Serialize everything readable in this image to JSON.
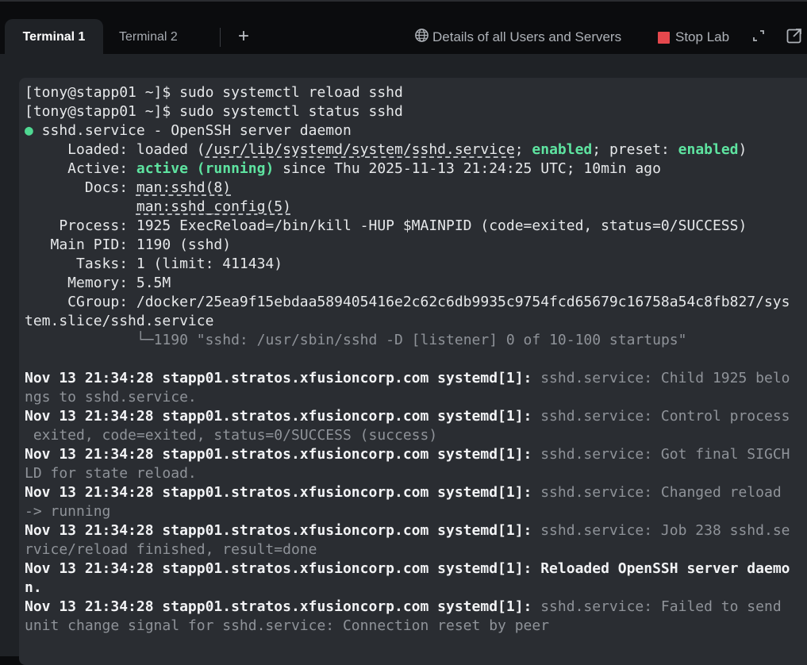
{
  "tabs": {
    "terminal1": "Terminal 1",
    "terminal2": "Terminal 2",
    "add": "+"
  },
  "toolbar": {
    "details_label": "Details of all Users and Servers",
    "stop_label": "Stop Lab",
    "stop_color": "#e5484d"
  },
  "icons": {
    "globe": "globe-icon",
    "expand": "expand-icon",
    "popout": "open-external-icon"
  },
  "terminal": {
    "l01_prompt": "[tony@stapp01 ~]$ ",
    "l01_cmd": "sudo systemctl reload sshd",
    "l02_prompt": "[tony@stapp01 ~]$ ",
    "l02_cmd": "sudo systemctl status sshd",
    "l03_dot": "●",
    "l03_text": " sshd.service - OpenSSH server daemon",
    "l04_a": "     Loaded: loaded (",
    "l04_path": "/usr/lib/systemd/system/sshd.service",
    "l04_b": "; ",
    "l04_en1": "enabled",
    "l04_c": "; preset: ",
    "l04_en2": "enabled",
    "l04_d": ")",
    "l05_a": "     Active: ",
    "l05_active": "active (running)",
    "l05_b": " since Thu 2025-11-13 21:24:25 UTC; 10min ago",
    "l06_a": "       Docs: ",
    "l06_doc": "man:sshd(8)",
    "l07_a": "             ",
    "l07_doc": "man:sshd_config(5)",
    "l08": "    Process: 1925 ExecReload=/bin/kill -HUP $MAINPID (code=exited, status=0/SUCCESS)",
    "l09": "   Main PID: 1190 (sshd)",
    "l10": "      Tasks: 1 (limit: 411434)",
    "l11": "     Memory: 5.5M",
    "l12": "     CGroup: /docker/25ea9f15ebdaa589405416e2c62c6db9935c9754fcd65679c16758a54c8fb827/sys",
    "l13": "tem.slice/sshd.service",
    "l14_a": "             ",
    "l14_b": "└─1190 \"sshd: /usr/sbin/sshd -D [listener] 0 of 10-100 startups\"",
    "l15": "",
    "log_prefix": "Nov 13 21:34:28 stapp01.stratos.xfusioncorp.com systemd[1]: ",
    "l16": "sshd.service: Child 1925 belo",
    "l17": "ngs to sshd.service.",
    "l18": "sshd.service: Control process",
    "l19": " exited, code=exited, status=0/SUCCESS (success)",
    "l20": "sshd.service: Got final SIGCH",
    "l21": "LD for state reload.",
    "l22": "sshd.service: Changed reload",
    "l23": "-> running",
    "l24": "sshd.service: Job 238 sshd.se",
    "l25": "rvice/reload finished, result=done",
    "l26": "Reloaded OpenSSH server daemo",
    "l27": "n.",
    "l28": "sshd.service: Failed to send",
    "l29": "unit change signal for sshd.service: Connection reset by peer"
  }
}
